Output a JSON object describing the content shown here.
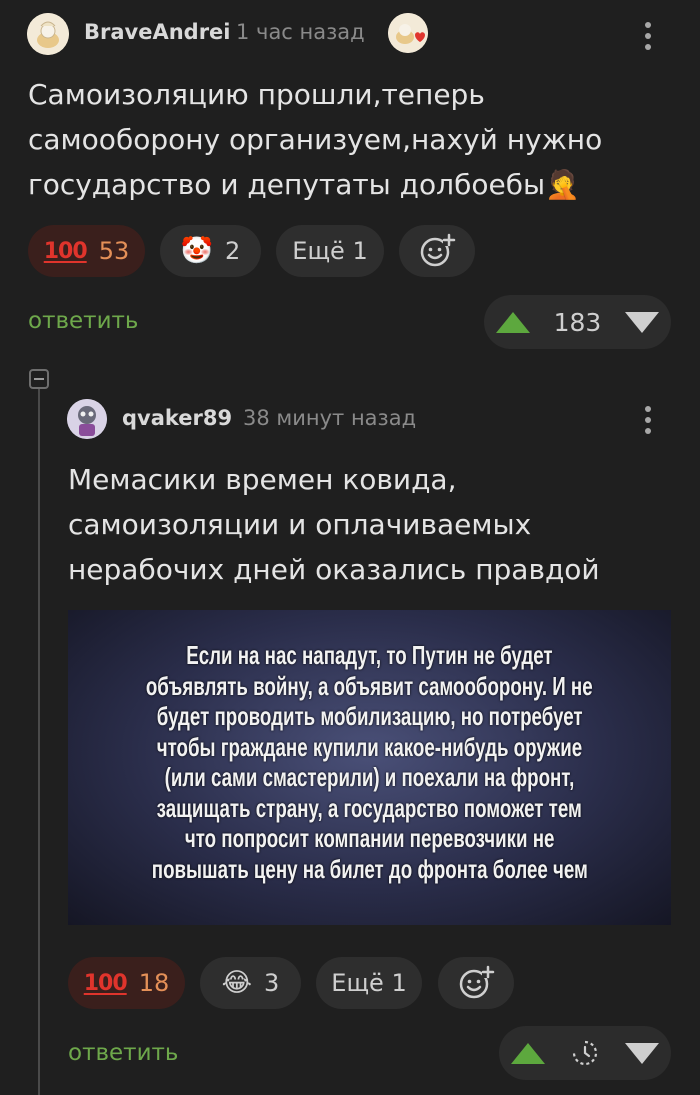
{
  "comment1": {
    "username": "BraveAndrei",
    "time": "1 час назад",
    "text_lines": [
      "Самоизоляцию прошли,теперь",
      "самооборону организуем,нахуй нужно",
      "государство и депутаты долбоебы🤦"
    ],
    "reactions": [
      {
        "icon": "100",
        "count": "53"
      },
      {
        "icon": "🤡",
        "count": "2"
      }
    ],
    "more_label": "Ещё 1",
    "reply_label": "ответить",
    "rating": "183"
  },
  "comment2": {
    "username": "qvaker89",
    "time": "38 минут назад",
    "text_lines": [
      "Мемасики времен ковида,",
      "самоизоляции и оплачиваемых",
      "нерабочих дней оказались правдой"
    ],
    "meme_lines": [
      "Если на нас нападут, то Путин не будет",
      "объявлять войну, а объявит самооборону. И не",
      "будет проводить мобилизацию, но потребует",
      "чтобы граждане купили какое-нибудь оружие",
      "(или сами смастерили) и поехали на фронт,",
      "защищать страну, а государство поможет тем",
      "что попросит компании перевозчики не",
      "повышать цену на билет до фронта более чем"
    ],
    "reactions": [
      {
        "icon": "100",
        "count": "18"
      },
      {
        "icon": "😂",
        "count": "3"
      }
    ],
    "more_label": "Ещё 1",
    "reply_label": "ответить"
  }
}
